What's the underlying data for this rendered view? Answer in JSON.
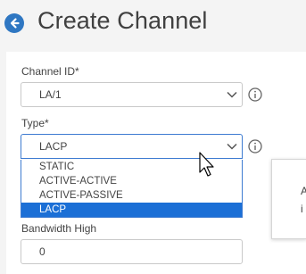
{
  "header": {
    "back_icon": "arrow-left-circle-icon",
    "title": "Create Channel"
  },
  "form": {
    "channel_id": {
      "label": "Channel ID*",
      "value": "LA/1",
      "info_icon": "info-circle-icon"
    },
    "type": {
      "label": "Type*",
      "value": "LACP",
      "info_icon": "info-circle-icon",
      "options": [
        {
          "label": "STATIC",
          "selected": false
        },
        {
          "label": "ACTIVE-ACTIVE",
          "selected": false
        },
        {
          "label": "ACTIVE-PASSIVE",
          "selected": false
        },
        {
          "label": "LACP",
          "selected": true
        }
      ]
    },
    "bandwidth_high": {
      "label": "Bandwidth High",
      "value": "0"
    }
  },
  "tooltip": {
    "lines": [
      "A",
      "i"
    ]
  },
  "colors": {
    "accent": "#2f77c2",
    "selected_option": "#1b6fd6",
    "focus_border": "#3d7bd1",
    "page_background": "#f4f4f4"
  }
}
